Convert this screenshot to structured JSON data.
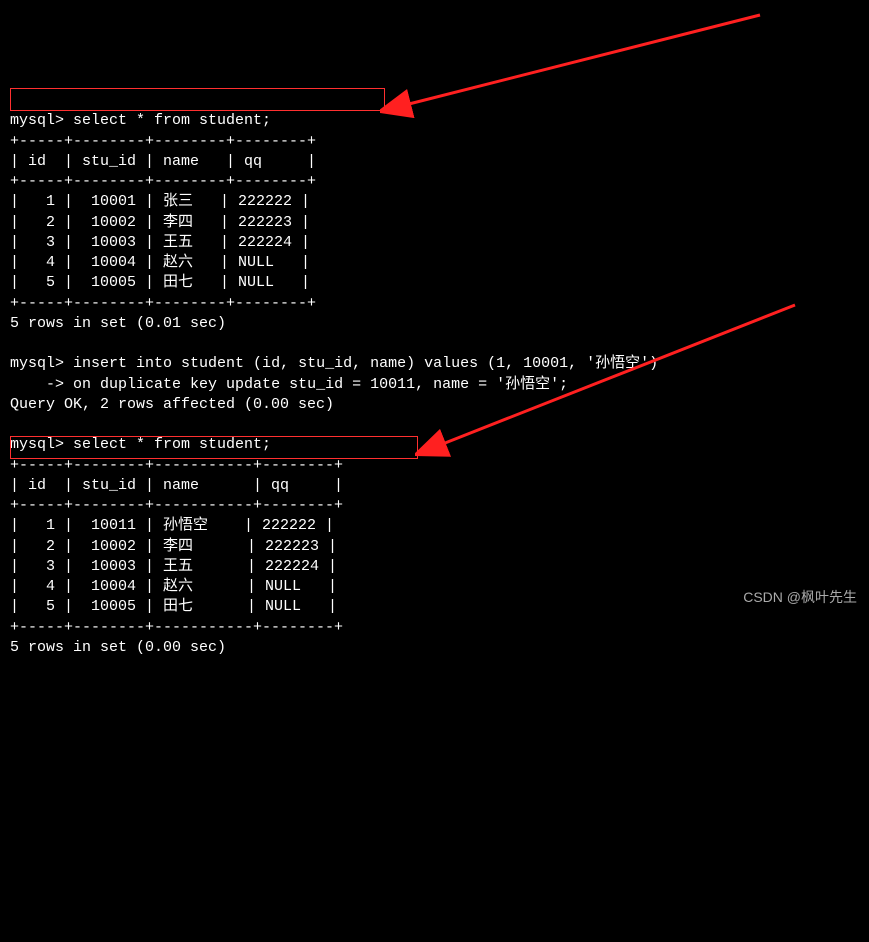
{
  "prompt": "mysql>",
  "continuation": "    ->",
  "query1": "select * from student;",
  "table1": {
    "border_top": "+-----+--------+--------+--------+",
    "header": "| id  | stu_id | name   | qq     |",
    "border_mid": "+-----+--------+--------+--------+",
    "rows": [
      "|   1 |  10001 | 张三   | 222222 |",
      "|   2 |  10002 | 李四   | 222223 |",
      "|   3 |  10003 | 王五   | 222224 |",
      "|   4 |  10004 | 赵六   | NULL   |",
      "|   5 |  10005 | 田七   | NULL   |"
    ],
    "border_bot": "+-----+--------+--------+--------+",
    "footer": "5 rows in set (0.01 sec)"
  },
  "query2_line1": "insert into student (id, stu_id, name) values (1, 10001, '孙悟空')",
  "query2_line2": "on duplicate key update stu_id = 10011, name = '孙悟空';",
  "query2_result": "Query OK, 2 rows affected (0.00 sec)",
  "query3": "select * from student;",
  "table2": {
    "border_top": "+-----+--------+-----------+--------+",
    "header": "| id  | stu_id | name      | qq     |",
    "border_mid": "+-----+--------+-----------+--------+",
    "rows": [
      "|   1 |  10011 | 孙悟空    | 222222 |",
      "|   2 |  10002 | 李四      | 222223 |",
      "|   3 |  10003 | 王五      | 222224 |",
      "|   4 |  10004 | 赵六      | NULL   |",
      "|   5 |  10005 | 田七      | NULL   |"
    ],
    "border_bot": "+-----+--------+-----------+--------+",
    "footer": "5 rows in set (0.00 sec)"
  },
  "watermark": "CSDN @枫叶先生"
}
